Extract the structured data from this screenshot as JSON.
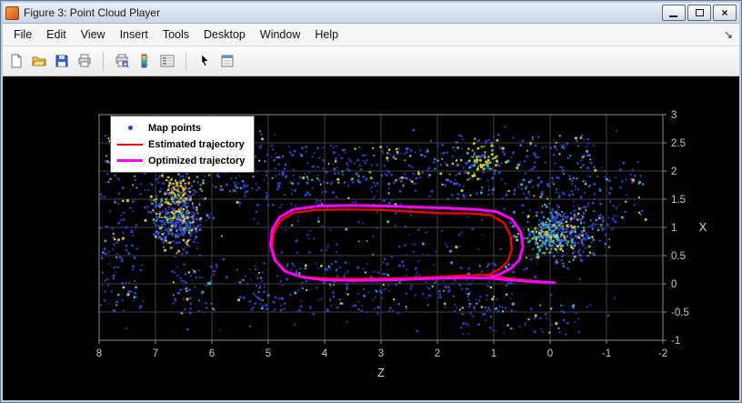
{
  "window": {
    "title": "Figure 3: Point Cloud Player",
    "close_glyph": "×"
  },
  "menubar": {
    "items": [
      "File",
      "Edit",
      "View",
      "Insert",
      "Tools",
      "Desktop",
      "Window",
      "Help"
    ],
    "dock_arrow": "↘"
  },
  "toolbar": {
    "icons": [
      "new-figure",
      "open-file",
      "save-figure",
      "print-figure",
      "separator",
      "print-preview",
      "insert-colorbar",
      "insert-legend",
      "separator",
      "edit-plot",
      "property-inspector"
    ]
  },
  "chart_data": {
    "type": "scatter",
    "title": "",
    "xlabel": "Z",
    "ylabel": "X",
    "background": "#000000",
    "grid": true,
    "grid_color": "#404040",
    "axis_color": "#8c8c8c",
    "tick_color": "#c4c4c4",
    "label_color": "#d2d2d2",
    "x_axis": {
      "range": [
        8,
        -2
      ],
      "reversed": true,
      "ticks": [
        8,
        7,
        6,
        5,
        4,
        3,
        2,
        1,
        0,
        -1,
        -2
      ]
    },
    "y_axis": {
      "range": [
        3,
        -1
      ],
      "location": "right",
      "ticks": [
        3,
        2.5,
        2,
        1.5,
        1,
        0.5,
        0,
        -0.5,
        -1
      ]
    },
    "legend": {
      "position": "top-left",
      "entries": [
        {
          "label": "Map points",
          "type": "point",
          "color": "#3242cf"
        },
        {
          "label": "Estimated trajectory",
          "type": "line",
          "color": "#ff0000",
          "line_width": 2
        },
        {
          "label": "Optimized trajectory",
          "type": "line",
          "color": "#ff00ff",
          "line_width": 3
        }
      ]
    },
    "palette": {
      "blue": "#3242cf",
      "deepblue": "#2230a0",
      "lightblue": "#5a6fe6",
      "cyan": "#2ec8dc",
      "green": "#5ac73a",
      "yellow": "#e5d431",
      "orange": "#f09f2e"
    },
    "seed": 42,
    "point_clusters": [
      {
        "z": [
          5.1,
          7.9
        ],
        "x": [
          1.6,
          2.75
        ],
        "n": 240,
        "dist": "uniform",
        "colors": {
          "blue": 0.55,
          "deepblue": 0.1,
          "lightblue": 0.1,
          "cyan": 0.05,
          "green": 0.07,
          "yellow": 0.13
        }
      },
      {
        "z": [
          2.2,
          5.1
        ],
        "x": [
          1.75,
          2.45
        ],
        "n": 190,
        "dist": "uniform",
        "colors": {
          "blue": 0.62,
          "deepblue": 0.12,
          "lightblue": 0.08,
          "cyan": 0.05,
          "green": 0.05,
          "yellow": 0.08
        }
      },
      {
        "z": [
          -0.8,
          2.2
        ],
        "x": [
          1.5,
          2.65
        ],
        "n": 260,
        "dist": "uniform",
        "colors": {
          "blue": 0.55,
          "deepblue": 0.1,
          "lightblue": 0.1,
          "cyan": 0.07,
          "green": 0.06,
          "yellow": 0.12
        }
      },
      {
        "z": [
          5.9,
          7.3
        ],
        "x": [
          0.35,
          2.0
        ],
        "n": 420,
        "dist": "gauss",
        "colors": {
          "blue": 0.5,
          "deepblue": 0.12,
          "lightblue": 0.1,
          "cyan": 0.04,
          "green": 0.06,
          "yellow": 0.18
        }
      },
      {
        "z": [
          7.2,
          8.05
        ],
        "x": [
          -0.5,
          1.6
        ],
        "n": 100,
        "dist": "uniform",
        "colors": {
          "blue": 0.62,
          "deepblue": 0.15,
          "lightblue": 0.08,
          "cyan": 0.05,
          "yellow": 0.1
        }
      },
      {
        "z": [
          0.6,
          5.6
        ],
        "x": [
          -0.5,
          0.4
        ],
        "n": 300,
        "dist": "uniform",
        "colors": {
          "blue": 0.62,
          "deepblue": 0.15,
          "lightblue": 0.08,
          "cyan": 0.08,
          "yellow": 0.07
        }
      },
      {
        "z": [
          -1.3,
          0.9
        ],
        "x": [
          0.15,
          1.65
        ],
        "n": 400,
        "dist": "gauss",
        "colors": {
          "blue": 0.45,
          "deepblue": 0.1,
          "lightblue": 0.12,
          "cyan": 0.15,
          "green": 0.05,
          "yellow": 0.13
        }
      },
      {
        "z": [
          1.2,
          4.8
        ],
        "x": [
          0.45,
          1.45
        ],
        "n": 70,
        "dist": "uniform",
        "colors": {
          "deepblue": 0.6,
          "blue": 0.3,
          "cyan": 0.1
        }
      },
      {
        "z": [
          -0.6,
          1.6
        ],
        "x": [
          -0.9,
          -0.35
        ],
        "n": 70,
        "dist": "uniform",
        "colors": {
          "blue": 0.6,
          "deepblue": 0.2,
          "cyan": 0.1,
          "yellow": 0.1
        }
      },
      {
        "z": [
          2.6,
          5.6
        ],
        "x": [
          1.35,
          1.8
        ],
        "n": 70,
        "dist": "uniform",
        "colors": {
          "blue": 0.7,
          "deepblue": 0.2,
          "yellow": 0.1
        }
      },
      {
        "z": [
          6.2,
          7.0
        ],
        "x": [
          0.9,
          2.3
        ],
        "n": 110,
        "dist": "gauss",
        "colors": {
          "yellow": 0.45,
          "green": 0.22,
          "orange": 0.1,
          "blue": 0.23
        }
      },
      {
        "z": [
          0.6,
          1.7
        ],
        "x": [
          1.8,
          2.5
        ],
        "n": 70,
        "dist": "gauss",
        "colors": {
          "yellow": 0.4,
          "green": 0.2,
          "cyan": 0.12,
          "blue": 0.28
        }
      },
      {
        "z": [
          -0.4,
          0.5
        ],
        "x": [
          0.4,
          1.3
        ],
        "n": 90,
        "dist": "gauss",
        "colors": {
          "cyan": 0.35,
          "yellow": 0.25,
          "lightblue": 0.2,
          "green": 0.2
        }
      },
      {
        "z": [
          5.9,
          6.7
        ],
        "x": [
          -0.55,
          0.35
        ],
        "n": 60,
        "dist": "uniform",
        "colors": {
          "blue": 0.6,
          "yellow": 0.15,
          "cyan": 0.15,
          "deepblue": 0.1
        }
      },
      {
        "z": [
          -1.7,
          -0.7
        ],
        "x": [
          1.1,
          2.2
        ],
        "n": 55,
        "dist": "uniform",
        "colors": {
          "blue": 0.6,
          "deepblue": 0.15,
          "cyan": 0.1,
          "yellow": 0.15
        }
      },
      {
        "z": [
          -1.2,
          8.0
        ],
        "x": [
          -0.85,
          2.8
        ],
        "n": 130,
        "dist": "uniform",
        "colors": {
          "deepblue": 0.6,
          "blue": 0.3,
          "yellow": 0.1
        }
      }
    ],
    "series": [
      {
        "name": "Estimated trajectory",
        "color": "#ff0000",
        "width": 2.2,
        "points": [
          [
            0.02,
            0.03
          ],
          [
            0.35,
            0.06
          ],
          [
            0.75,
            0.1
          ],
          [
            1.1,
            0.16
          ],
          [
            1.5,
            0.15
          ],
          [
            2.1,
            0.12
          ],
          [
            2.7,
            0.1
          ],
          [
            3.3,
            0.09
          ],
          [
            3.9,
            0.09
          ],
          [
            4.35,
            0.12
          ],
          [
            4.65,
            0.2
          ],
          [
            4.85,
            0.38
          ],
          [
            4.93,
            0.62
          ],
          [
            4.9,
            0.9
          ],
          [
            4.78,
            1.12
          ],
          [
            4.55,
            1.26
          ],
          [
            4.15,
            1.31
          ],
          [
            3.6,
            1.32
          ],
          [
            3.0,
            1.31
          ],
          [
            2.45,
            1.28
          ],
          [
            1.9,
            1.25
          ],
          [
            1.45,
            1.25
          ],
          [
            1.05,
            1.22
          ],
          [
            0.82,
            1.08
          ],
          [
            0.7,
            0.85
          ],
          [
            0.68,
            0.6
          ],
          [
            0.75,
            0.4
          ],
          [
            0.9,
            0.26
          ],
          [
            1.05,
            0.18
          ],
          [
            1.12,
            0.14
          ]
        ]
      },
      {
        "name": "Optimized trajectory",
        "color": "#ff00ff",
        "width": 3,
        "points": [
          [
            -0.08,
            0.02
          ],
          [
            0.3,
            0.04
          ],
          [
            0.7,
            0.07
          ],
          [
            1.1,
            0.1
          ],
          [
            1.6,
            0.11
          ],
          [
            2.2,
            0.09
          ],
          [
            2.9,
            0.07
          ],
          [
            3.5,
            0.06
          ],
          [
            4.0,
            0.07
          ],
          [
            4.4,
            0.12
          ],
          [
            4.7,
            0.22
          ],
          [
            4.88,
            0.42
          ],
          [
            4.96,
            0.68
          ],
          [
            4.93,
            0.95
          ],
          [
            4.8,
            1.18
          ],
          [
            4.55,
            1.32
          ],
          [
            4.1,
            1.38
          ],
          [
            3.55,
            1.39
          ],
          [
            2.95,
            1.38
          ],
          [
            2.35,
            1.36
          ],
          [
            1.8,
            1.34
          ],
          [
            1.3,
            1.32
          ],
          [
            0.95,
            1.28
          ],
          [
            0.68,
            1.15
          ],
          [
            0.52,
            0.92
          ],
          [
            0.48,
            0.65
          ],
          [
            0.55,
            0.42
          ],
          [
            0.7,
            0.27
          ],
          [
            0.9,
            0.17
          ],
          [
            1.05,
            0.12
          ]
        ]
      }
    ]
  }
}
